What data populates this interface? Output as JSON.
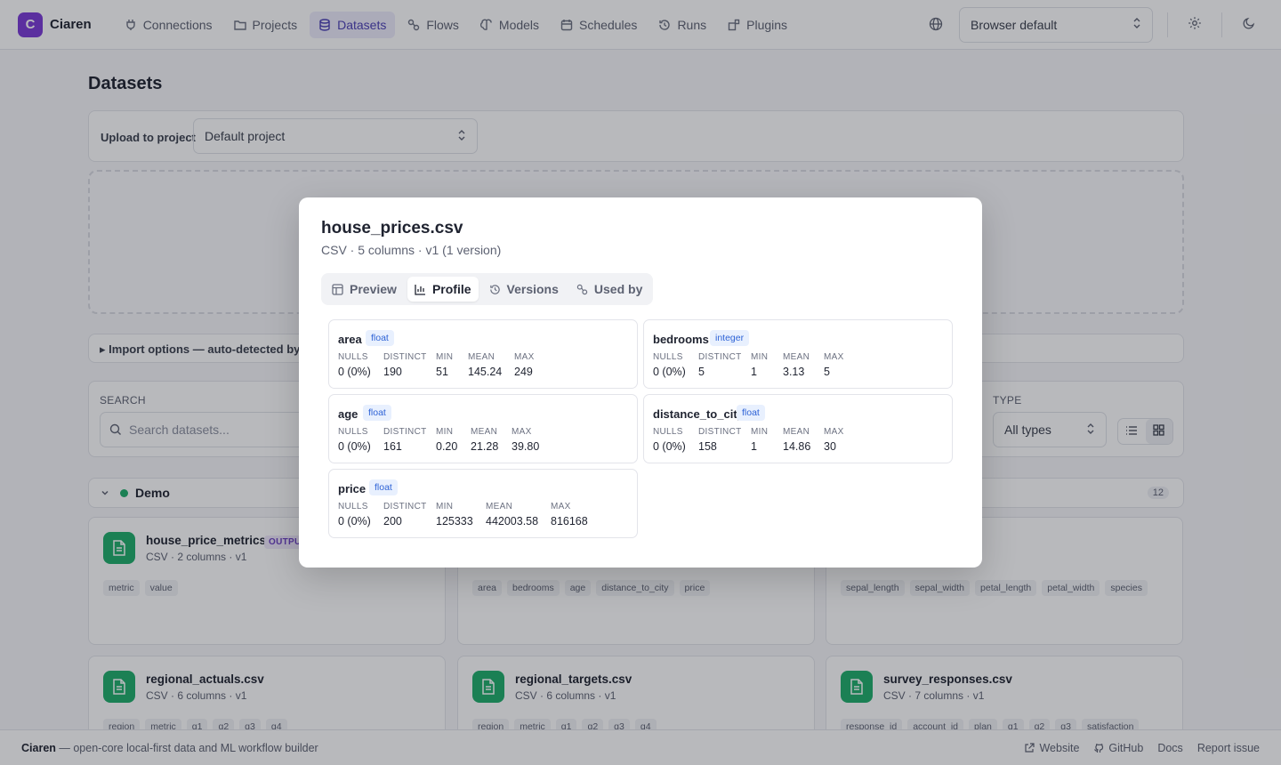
{
  "brand": {
    "initial": "C",
    "name": "Ciaren"
  },
  "nav": {
    "items": [
      {
        "label": "Connections",
        "icon": "plug-icon"
      },
      {
        "label": "Projects",
        "icon": "folder-icon"
      },
      {
        "label": "Datasets",
        "icon": "database-icon",
        "active": true
      },
      {
        "label": "Flows",
        "icon": "flow-icon"
      },
      {
        "label": "Models",
        "icon": "brain-icon"
      },
      {
        "label": "Schedules",
        "icon": "calendar-icon"
      },
      {
        "label": "Runs",
        "icon": "history-icon"
      },
      {
        "label": "Plugins",
        "icon": "plugin-icon"
      }
    ],
    "language": "Browser default"
  },
  "page": {
    "title": "Datasets",
    "upload_label": "Upload to project",
    "project_value": "Default project",
    "import_label": "Import options — auto-detected by de",
    "search_caption": "SEARCH",
    "search_placeholder": "Search datasets...",
    "type_caption": "TYPE",
    "type_value": "All types",
    "group": {
      "name": "Demo",
      "count": "12"
    }
  },
  "cards": [
    {
      "name": "house_price_metrics",
      "badge": "OUTPUT",
      "meta": "CSV · 2 columns · v1",
      "tags": [
        "metric",
        "value"
      ]
    },
    {
      "name": "",
      "meta": "",
      "tags": [
        "area",
        "bedrooms",
        "age",
        "distance_to_city",
        "price"
      ]
    },
    {
      "name": "",
      "meta": "",
      "tags": [
        "sepal_length",
        "sepal_width",
        "petal_length",
        "petal_width",
        "species"
      ]
    },
    {
      "name": "regional_actuals.csv",
      "meta": "CSV · 6 columns · v1",
      "tags": [
        "region",
        "metric",
        "q1",
        "q2",
        "q3",
        "q4"
      ]
    },
    {
      "name": "regional_targets.csv",
      "meta": "CSV · 6 columns · v1",
      "tags": [
        "region",
        "metric",
        "q1",
        "q2",
        "q3",
        "q4"
      ]
    },
    {
      "name": "survey_responses.csv",
      "meta": "CSV · 7 columns · v1",
      "tags": [
        "response_id",
        "account_id",
        "plan",
        "q1",
        "q2",
        "q3",
        "satisfaction"
      ]
    }
  ],
  "footer": {
    "brand": "Ciaren",
    "tagline": " — open-core local-first data and ML workflow builder",
    "links": [
      "Website",
      "GitHub",
      "Docs",
      "Report issue"
    ]
  },
  "modal": {
    "title": "house_prices.csv",
    "subtitle": "CSV · 5 columns · v1 (1 version)",
    "tabs": [
      {
        "label": "Preview",
        "icon": "table-icon"
      },
      {
        "label": "Profile",
        "icon": "bar-chart-icon",
        "active": true
      },
      {
        "label": "Versions",
        "icon": "history-icon"
      },
      {
        "label": "Used by",
        "icon": "link-icon"
      }
    ],
    "stat_labels": {
      "nulls": "NULLS",
      "distinct": "DISTINCT",
      "min": "MIN",
      "mean": "MEAN",
      "max": "MAX"
    },
    "columns": [
      {
        "name": "area",
        "type": "float",
        "nulls": "0 (0%)",
        "distinct": "190",
        "min": "51",
        "mean": "145.24",
        "max": "249"
      },
      {
        "name": "bedrooms",
        "type": "integer",
        "nulls": "0 (0%)",
        "distinct": "5",
        "min": "1",
        "mean": "3.13",
        "max": "5"
      },
      {
        "name": "age",
        "type": "float",
        "nulls": "0 (0%)",
        "distinct": "161",
        "min": "0.20",
        "mean": "21.28",
        "max": "39.80"
      },
      {
        "name": "distance_to_city",
        "type": "float",
        "nulls": "0 (0%)",
        "distinct": "158",
        "min": "1",
        "mean": "14.86",
        "max": "30"
      },
      {
        "name": "price",
        "type": "float",
        "nulls": "0 (0%)",
        "distinct": "200",
        "min": "125333",
        "mean": "442003.58",
        "max": "816168"
      }
    ]
  }
}
